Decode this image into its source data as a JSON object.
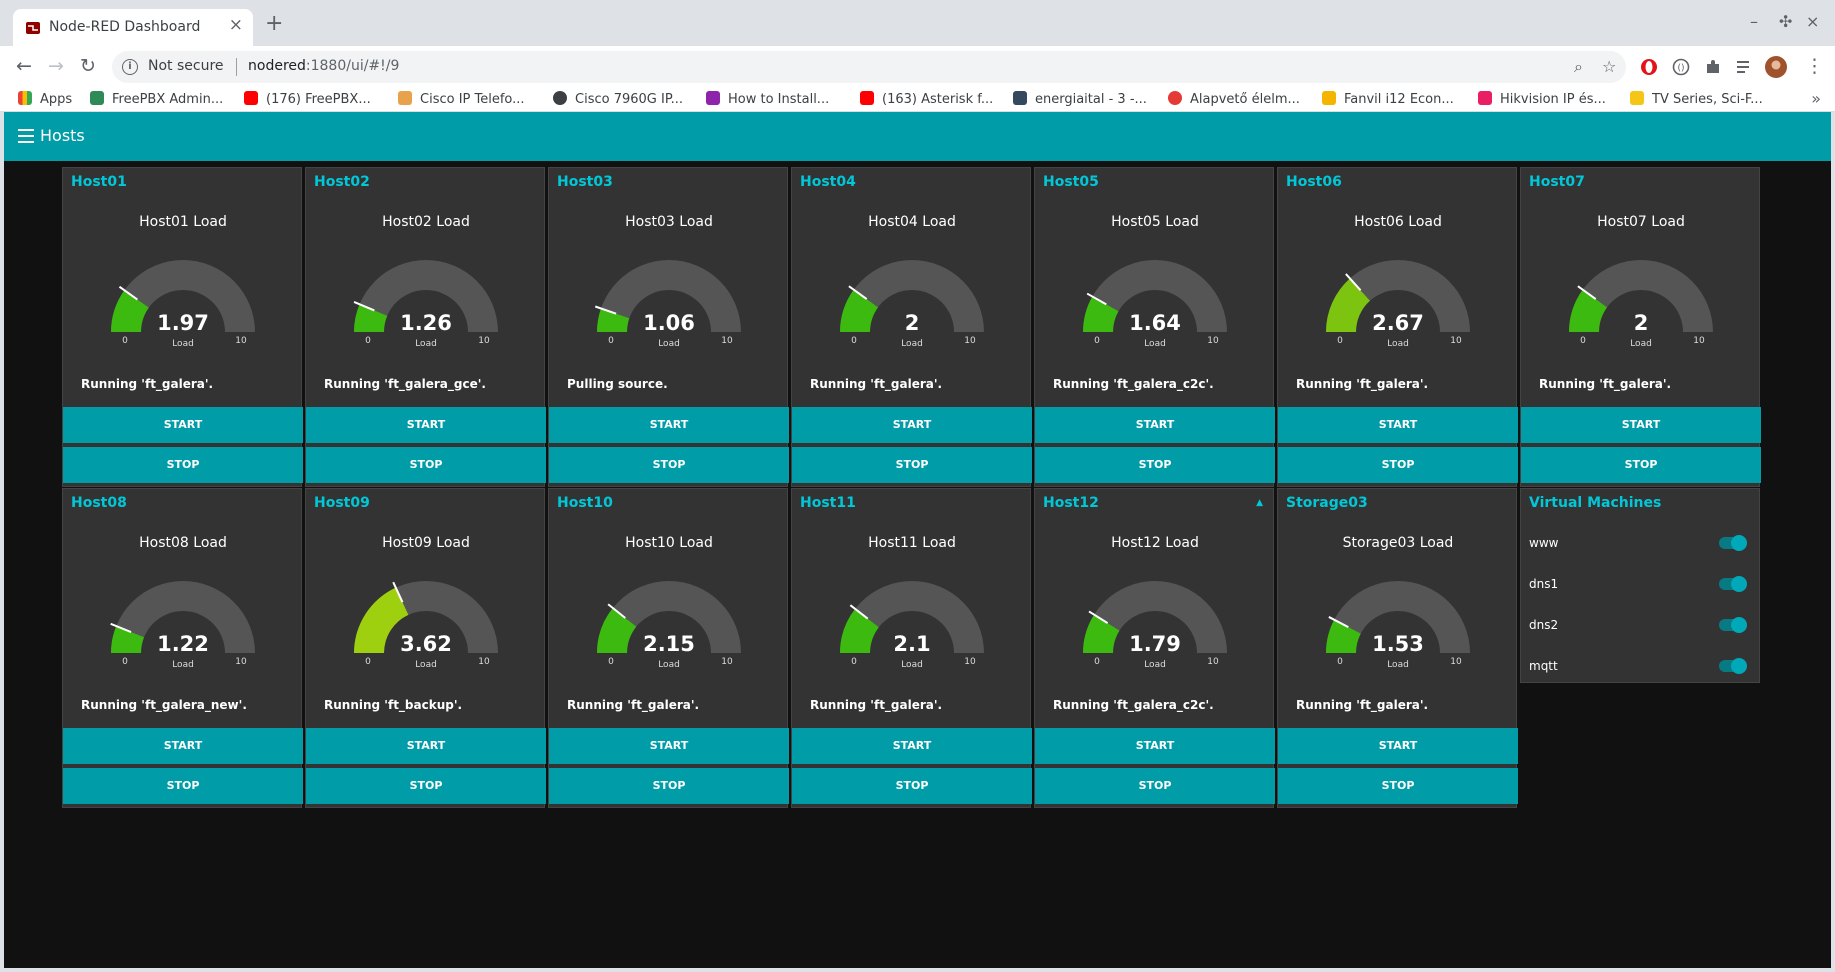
{
  "browser": {
    "tab_title": "Node-RED Dashboard",
    "security_label": "Not secure",
    "url_host": "nodered",
    "url_rest": ":1880/ui/#!/9",
    "bookmarks": [
      {
        "label": "Apps",
        "color": "#ea4335"
      },
      {
        "label": "FreePBX Admin...",
        "color": "#2e8b57"
      },
      {
        "label": "(176) FreePBX...",
        "color": "#ff0000"
      },
      {
        "label": "Cisco IP Telefo...",
        "color": "#e8a24b"
      },
      {
        "label": "Cisco 7960G IP...",
        "color": "#3c4043"
      },
      {
        "label": "How to Install...",
        "color": "#8e24aa"
      },
      {
        "label": "(163) Asterisk f...",
        "color": "#ff0000"
      },
      {
        "label": "energiaital - 3 -...",
        "color": "#34495e"
      },
      {
        "label": "Alapvető élelm...",
        "color": "#e53935"
      },
      {
        "label": "Fanvil i12 Econ...",
        "color": "#f4b400"
      },
      {
        "label": "Hikvision IP és...",
        "color": "#e91e63"
      },
      {
        "label": "TV Series, Sci-F...",
        "color": "#f5c518"
      }
    ]
  },
  "dashboard": {
    "title": "Hosts",
    "hosts": [
      {
        "name": "Host01",
        "gauge_label": "Host01 Load",
        "value": "1.97",
        "status": "Running 'ft_galera'.",
        "start_label": "START",
        "stop_label": "STOP"
      },
      {
        "name": "Host02",
        "gauge_label": "Host02 Load",
        "value": "1.26",
        "status": "Running 'ft_galera_gce'.",
        "start_label": "START",
        "stop_label": "STOP"
      },
      {
        "name": "Host03",
        "gauge_label": "Host03 Load",
        "value": "1.06",
        "status": "Pulling source.",
        "start_label": "START",
        "stop_label": "STOP"
      },
      {
        "name": "Host04",
        "gauge_label": "Host04 Load",
        "value": "2",
        "status": "Running 'ft_galera'.",
        "start_label": "START",
        "stop_label": "STOP"
      },
      {
        "name": "Host05",
        "gauge_label": "Host05 Load",
        "value": "1.64",
        "status": "Running 'ft_galera_c2c'.",
        "start_label": "START",
        "stop_label": "STOP"
      },
      {
        "name": "Host06",
        "gauge_label": "Host06 Load",
        "value": "2.67",
        "status": "Running 'ft_galera'.",
        "start_label": "START",
        "stop_label": "STOP"
      },
      {
        "name": "Host07",
        "gauge_label": "Host07 Load",
        "value": "2",
        "status": "Running 'ft_galera'.",
        "start_label": "START",
        "stop_label": "STOP"
      },
      {
        "name": "Host08",
        "gauge_label": "Host08 Load",
        "value": "1.22",
        "status": "Running 'ft_galera_new'.",
        "start_label": "START",
        "stop_label": "STOP"
      },
      {
        "name": "Host09",
        "gauge_label": "Host09 Load",
        "value": "3.62",
        "status": "Running 'ft_backup'.",
        "start_label": "START",
        "stop_label": "STOP"
      },
      {
        "name": "Host10",
        "gauge_label": "Host10 Load",
        "value": "2.15",
        "status": "Running 'ft_galera'.",
        "start_label": "START",
        "stop_label": "STOP"
      },
      {
        "name": "Host11",
        "gauge_label": "Host11 Load",
        "value": "2.1",
        "status": "Running 'ft_galera'.",
        "start_label": "START",
        "stop_label": "STOP"
      },
      {
        "name": "Host12",
        "gauge_label": "Host12 Load",
        "value": "1.79",
        "status": "Running 'ft_galera_c2c'.",
        "start_label": "START",
        "stop_label": "STOP"
      },
      {
        "name": "Storage03",
        "gauge_label": "Storage03 Load",
        "value": "1.53",
        "status": "Running 'ft_galera'.",
        "start_label": "START",
        "stop_label": "STOP"
      }
    ],
    "gauge": {
      "min": "0",
      "max": "10",
      "units": "Load",
      "arc_color": "#555555",
      "low_color": "#3cba10",
      "high_color": "#9ed010"
    },
    "vm_group": {
      "title": "Virtual Machines",
      "items": [
        {
          "label": "www",
          "on": true
        },
        {
          "label": "dns1",
          "on": true
        },
        {
          "label": "dns2",
          "on": true
        },
        {
          "label": "mqtt",
          "on": true
        }
      ]
    }
  },
  "colors": {
    "accent": "#009ca8",
    "title": "#00c8d8",
    "card": "#333333",
    "background": "#111111"
  }
}
